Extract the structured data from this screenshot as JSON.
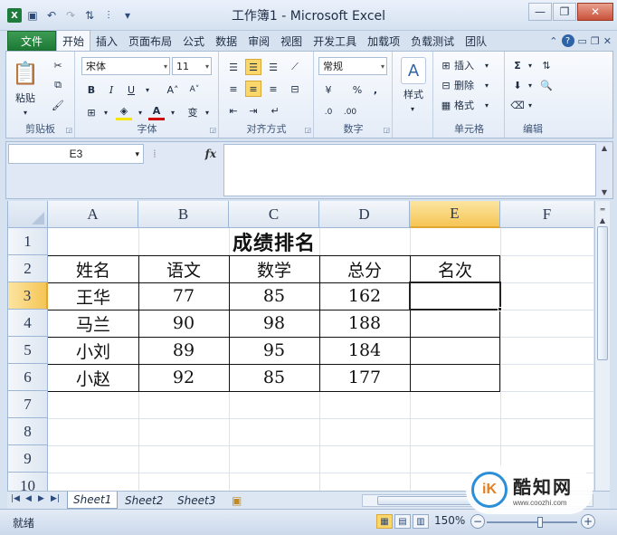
{
  "window": {
    "title": "工作簿1 - Microsoft Excel",
    "minimize": "—",
    "restore": "❐",
    "close": "✕"
  },
  "qat": {
    "app_icon": "X",
    "icons": [
      "save-icon",
      "undo-icon",
      "redo-icon",
      "customize-icon"
    ]
  },
  "ribbon_tabs": {
    "file": "文件",
    "tabs": [
      "开始",
      "插入",
      "页面布局",
      "公式",
      "数据",
      "审阅",
      "视图",
      "开发工具",
      "加载项",
      "负载测试",
      "团队"
    ],
    "active": "开始"
  },
  "ribbon": {
    "clipboard": {
      "label": "剪贴板",
      "paste": "粘贴"
    },
    "font": {
      "label": "字体",
      "name": "宋体",
      "size": "11",
      "bold": "B",
      "italic": "I",
      "underline": "U",
      "grow": "A˄",
      "shrink": "A˅",
      "wen": "变"
    },
    "alignment": {
      "label": "对齐方式"
    },
    "number": {
      "label": "数字",
      "format": "常规",
      "percent": "%",
      "comma": ","
    },
    "styles": {
      "label": "样式",
      "button": "样式"
    },
    "cells": {
      "label": "单元格",
      "insert": "插入",
      "delete": "删除",
      "format": "格式"
    },
    "editing": {
      "label": "编辑",
      "sum": "Σ"
    }
  },
  "formula_bar": {
    "name_box": "E3",
    "fx": "fx",
    "value": ""
  },
  "grid": {
    "columns": [
      "A",
      "B",
      "C",
      "D",
      "E",
      "F"
    ],
    "rows": [
      "1",
      "2",
      "3",
      "4",
      "5",
      "6",
      "7",
      "8",
      "9",
      "10"
    ],
    "selected_column": "E",
    "selected_row": "3",
    "title": "成绩排名",
    "headers": [
      "姓名",
      "语文",
      "数学",
      "总分",
      "名次"
    ],
    "data": [
      [
        "王华",
        "77",
        "85",
        "162",
        ""
      ],
      [
        "马兰",
        "90",
        "98",
        "188",
        ""
      ],
      [
        "小刘",
        "89",
        "95",
        "184",
        ""
      ],
      [
        "小赵",
        "92",
        "85",
        "177",
        ""
      ]
    ]
  },
  "sheet_tabs": [
    "Sheet1",
    "Sheet2",
    "Sheet3"
  ],
  "active_sheet": "Sheet1",
  "status": {
    "ready": "就绪",
    "zoom": "150%"
  },
  "watermark": {
    "name": "酷知网",
    "url": "www.coozhi.com"
  },
  "colors": {
    "file_tab": "#1d7a36",
    "selection_header": "#f6c555",
    "accent": "#2f63a8"
  }
}
